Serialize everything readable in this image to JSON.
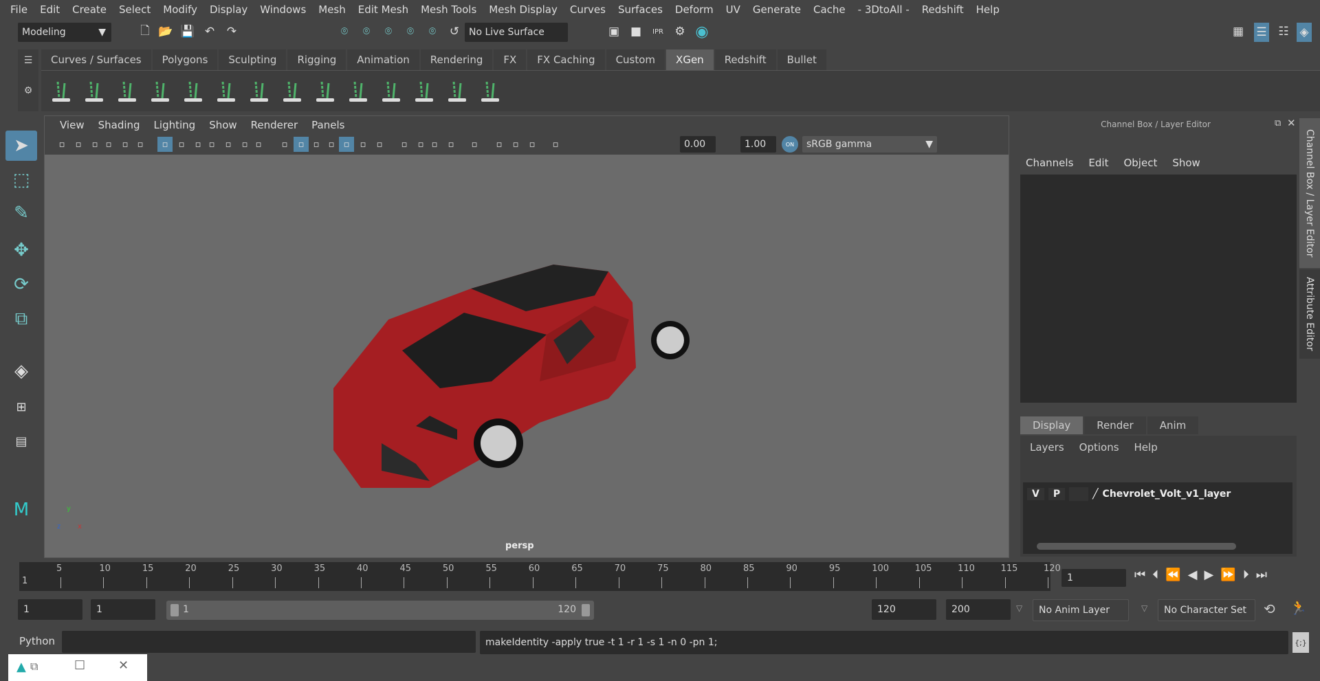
{
  "menubar": [
    "File",
    "Edit",
    "Create",
    "Select",
    "Modify",
    "Display",
    "Windows",
    "Mesh",
    "Edit Mesh",
    "Mesh Tools",
    "Mesh Display",
    "Curves",
    "Surfaces",
    "Deform",
    "UV",
    "Generate",
    "Cache",
    "- 3DtoAll -",
    "Redshift",
    "Help"
  ],
  "toolbar": {
    "mode": "Modeling",
    "live_surface": "No Live Surface"
  },
  "shelf": {
    "tabs": [
      "Curves / Surfaces",
      "Polygons",
      "Sculpting",
      "Rigging",
      "Animation",
      "Rendering",
      "FX",
      "FX Caching",
      "Custom",
      "XGen",
      "Redshift",
      "Bullet"
    ],
    "active": "XGen",
    "icons": [
      "xgen-editor-icon",
      "xgen-preview-icon",
      "xgen-clear-icon",
      "add-guides-icon",
      "place-guides-icon",
      "add-guide-icon",
      "select-guide-icon",
      "lock-guide-icon",
      "guides-length-icon",
      "convert-icon",
      "rebuild-icon",
      "sculpt-guides-icon",
      "groom-icon",
      "delete-guides-icon"
    ]
  },
  "viewport": {
    "menus": [
      "View",
      "Shading",
      "Lighting",
      "Show",
      "Renderer",
      "Panels"
    ],
    "exposure": "0.00",
    "gamma": "1.00",
    "color_toggle": "ON",
    "color_space": "sRGB gamma",
    "camera_label": "persp",
    "axis_x": "x",
    "axis_y": "y",
    "axis_z": "z"
  },
  "channel_box": {
    "title": "Channel Box / Layer Editor",
    "menus": [
      "Channels",
      "Edit",
      "Object",
      "Show"
    ]
  },
  "layer_editor": {
    "tabs": [
      "Display",
      "Render",
      "Anim"
    ],
    "active": "Display",
    "menus": [
      "Layers",
      "Options",
      "Help"
    ],
    "layers": [
      {
        "v": "V",
        "p": "P",
        "name": "Chevrolet_Volt_v1_layer"
      }
    ]
  },
  "side_tabs": [
    "Channel Box / Layer Editor",
    "Attribute Editor"
  ],
  "timeline": {
    "start_label": "1",
    "ticks": [
      5,
      10,
      15,
      20,
      25,
      30,
      35,
      40,
      45,
      50,
      55,
      60,
      65,
      70,
      75,
      80,
      85,
      90,
      95,
      100,
      105,
      110,
      115,
      120
    ],
    "current_frame": "1",
    "min": 1,
    "max": 120
  },
  "range": {
    "start": "1",
    "anim_start": "1",
    "slider_start": "1",
    "slider_end": "120",
    "anim_end": "120",
    "end": "200",
    "anim_layer": "No Anim Layer",
    "character_set": "No Character Set"
  },
  "command": {
    "language": "Python",
    "input": "",
    "result": "makeIdentity -apply true -t 1 -r 1 -s 1 -n 0 -pn 1;"
  },
  "colors": {
    "accent": "#5285a6",
    "xgen_green": "#4fb36b",
    "car": "#a51e22"
  }
}
